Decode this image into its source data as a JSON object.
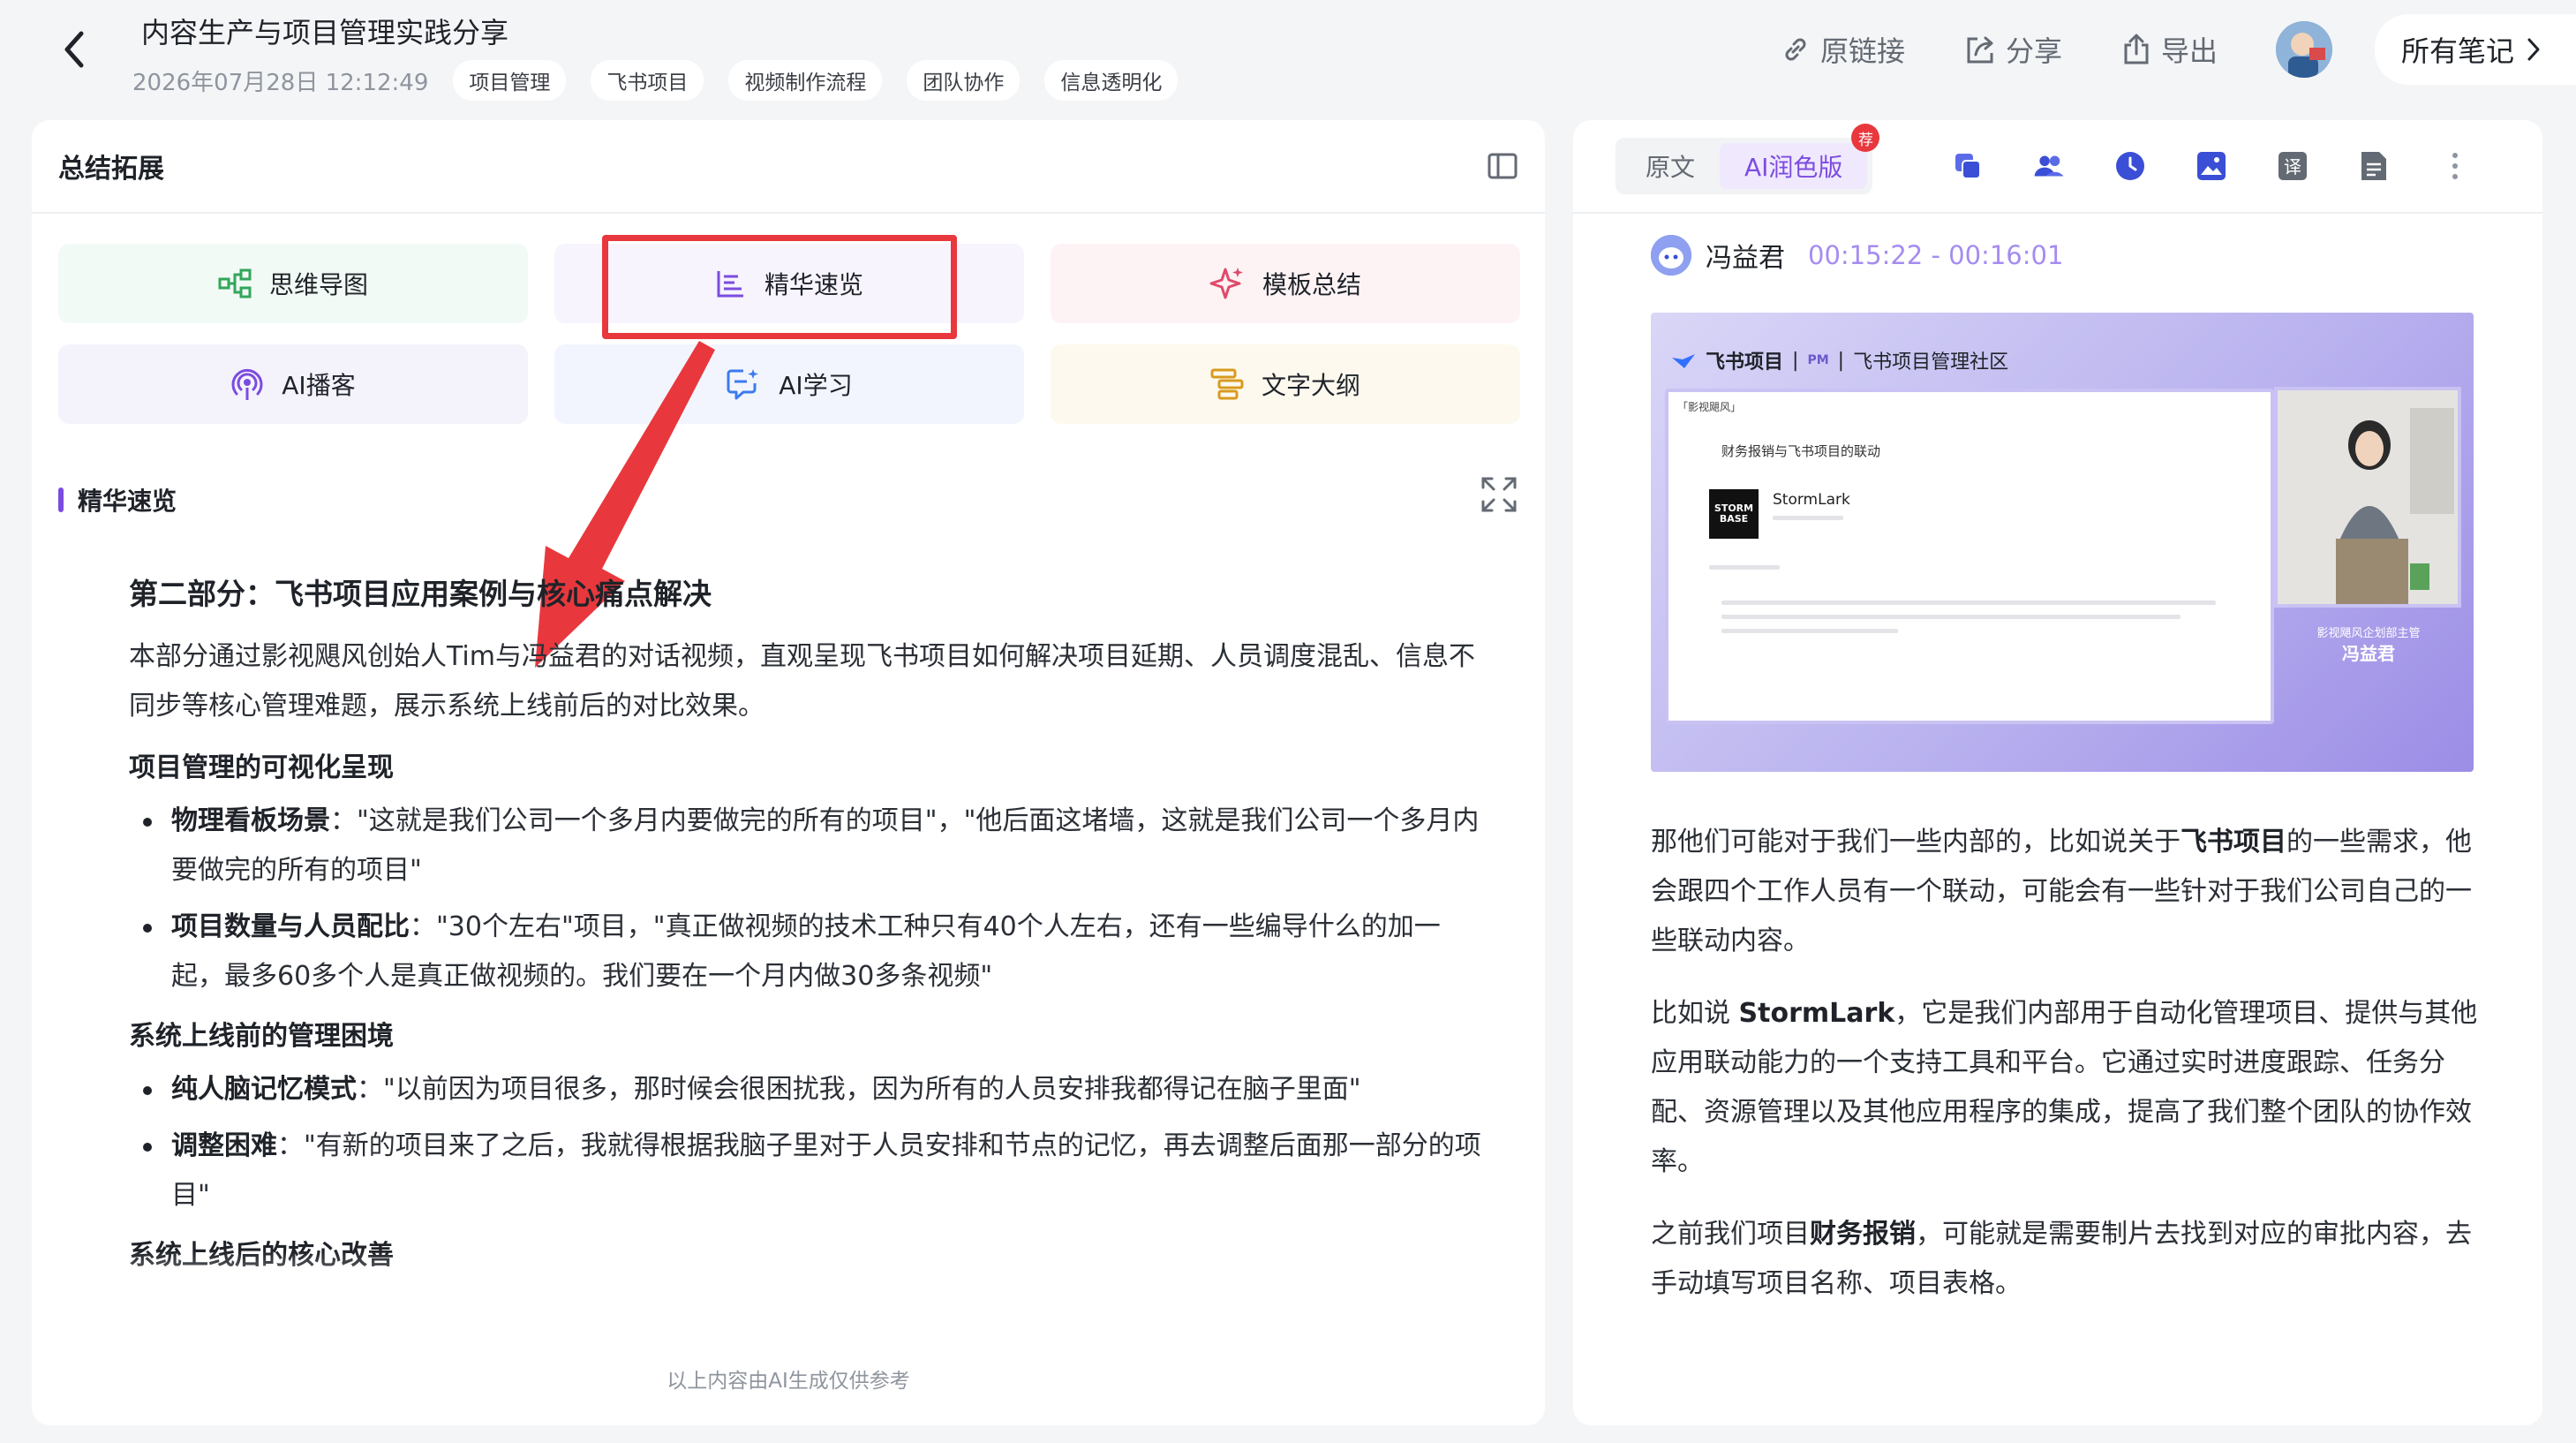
{
  "header": {
    "title": "内容生产与项目管理实践分享",
    "date": "2026年07月28日 12:12:49",
    "tags": [
      "项目管理",
      "飞书项目",
      "视频制作流程",
      "团队协作",
      "信息透明化"
    ],
    "actions": {
      "source_link": "原链接",
      "share": "分享",
      "export": "导出"
    },
    "all_notes": "所有笔记"
  },
  "left": {
    "panel_title": "总结拓展",
    "tools": [
      {
        "label": "思维导图",
        "icon": "mindmap-icon"
      },
      {
        "label": "精华速览",
        "icon": "highlights-icon"
      },
      {
        "label": "模板总结",
        "icon": "sparkle-icon"
      },
      {
        "label": "AI播客",
        "icon": "podcast-icon"
      },
      {
        "label": "AI学习",
        "icon": "ai-learn-icon"
      },
      {
        "label": "文字大纲",
        "icon": "outline-icon"
      }
    ],
    "section_label": "精华速览",
    "content": {
      "heading": "第二部分：飞书项目应用案例与核心痛点解决",
      "intro": "本部分通过影视飓风创始人Tim与冯益君的对话视频，直观呈现飞书项目如何解决项目延期、人员调度混乱、信息不同步等核心管理难题，展示系统上线前后的对比效果。",
      "sections": [
        {
          "title": "项目管理的可视化呈现",
          "items": [
            {
              "bold": "物理看板场景",
              "text": "：\"这就是我们公司一个多月内要做完的所有的项目\"，\"他后面这堵墙，这就是我们公司一个多月内要做完的所有的项目\""
            },
            {
              "bold": "项目数量与人员配比",
              "text": "：\"30个左右\"项目，\"真正做视频的技术工种只有40个人左右，还有一些编导什么的加一起，最多60多个人是真正做视频的。我们要在一个月内做30多条视频\""
            }
          ]
        },
        {
          "title": "系统上线前的管理困境",
          "items": [
            {
              "bold": "纯人脑记忆模式",
              "text": "：\"以前因为项目很多，那时候会很困扰我，因为所有的人员安排我都得记在脑子里面\""
            },
            {
              "bold": "调整困难",
              "text": "：\"有新的项目来了之后，我就得根据我脑子里对于人员安排和节点的记忆，再去调整后面那一部分的项目\""
            }
          ]
        },
        {
          "title": "系统上线后的核心改善",
          "items": []
        }
      ]
    },
    "footer_note": "以上内容由AI生成仅供参考"
  },
  "right": {
    "tabs": {
      "original": "原文",
      "ai_polished": "AI润色版",
      "badge": "荐"
    },
    "speaker": {
      "name": "冯益君",
      "time": "00:15:22 - 00:16:01"
    },
    "video": {
      "brand": "飞书项目",
      "community": "飞书项目管理社区",
      "screen_label": "「影视飓风」",
      "screen_title": "财务报销与飞书项目的联动",
      "product_name": "StormLark",
      "logo_text": "STORM BASE",
      "caption_small": "影视飓风企划部主管",
      "caption_name": "冯益君"
    },
    "paragraphs": [
      [
        {
          "t": "那他们可能对于我们一些内部的，比如说关于"
        },
        {
          "b": "飞书项目"
        },
        {
          "t": "的一些需求，他会跟四个工作人员有一个联动，可能会有一些针对于我们公司自己的一些联动内容。"
        }
      ],
      [
        {
          "t": "比如说 "
        },
        {
          "b": "StormLark"
        },
        {
          "t": "，它是我们内部用于自动化管理项目、提供与其他应用联动能力的一个支持工具和平台。它通过实时进度跟踪、任务分配、资源管理以及其他应用程序的集成，提高了我们整个团队的协作效率。"
        }
      ],
      [
        {
          "t": "之前我们项目"
        },
        {
          "b": "财务报销"
        },
        {
          "t": "，可能就是需要制片去找到对应的审批内容，去手动填写项目名称、项目表格。"
        }
      ]
    ]
  },
  "colors": {
    "accent_purple": "#7b4ce0",
    "highlight_red": "#e8383d",
    "muted_text": "#8f959e"
  }
}
